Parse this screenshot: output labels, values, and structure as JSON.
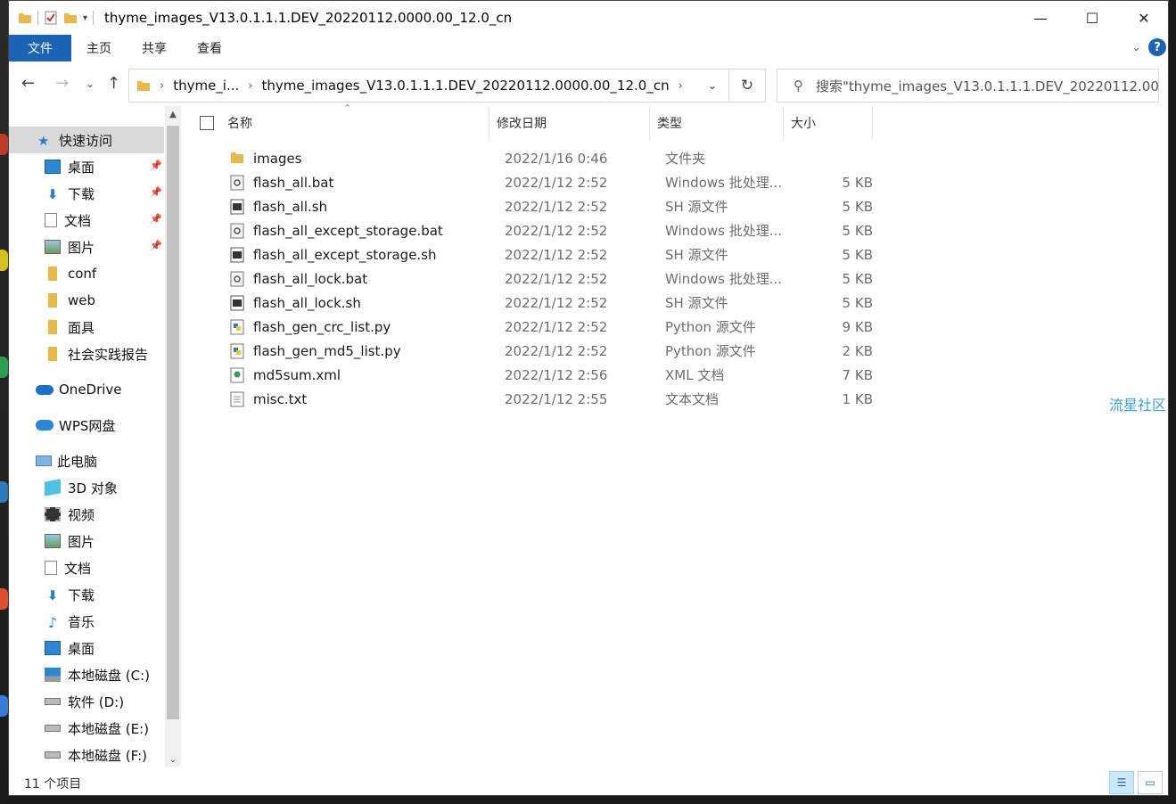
{
  "window": {
    "title": "thyme_images_V13.0.1.1.1.DEV_20220112.0000.00_12.0_cn",
    "controls": {
      "minimize": "—",
      "maximize": "☐",
      "close": "✕"
    }
  },
  "ribbon": {
    "tabs": [
      "文件",
      "主页",
      "共享",
      "查看"
    ],
    "help": "?"
  },
  "address": {
    "crumbs": [
      "thyme_i...",
      "thyme_images_V13.0.1.1.1.DEV_20220112.0000.00_12.0_cn"
    ],
    "search_placeholder": "搜索\"thyme_images_V13.0.1.1.1.DEV_20220112.00..."
  },
  "nav": {
    "quick_access": "快速访问",
    "pinned": [
      "桌面",
      "下载",
      "文档",
      "图片"
    ],
    "recent": [
      "conf",
      "web",
      "面具",
      "社会实践报告"
    ],
    "onedrive": "OneDrive",
    "wps": "WPS网盘",
    "this_pc": "此电脑",
    "pc_items": [
      "3D 对象",
      "视频",
      "图片",
      "文档",
      "下载",
      "音乐",
      "桌面",
      "本地磁盘 (C:)",
      "软件 (D:)",
      "本地磁盘 (E:)",
      "本地磁盘 (F:)"
    ]
  },
  "columns": {
    "name": "名称",
    "date": "修改日期",
    "type": "类型",
    "size": "大小"
  },
  "files": [
    {
      "name": "images",
      "date": "2022/1/16 0:46",
      "type": "文件夹",
      "size": "",
      "icon": "folder-icon"
    },
    {
      "name": "flash_all.bat",
      "date": "2022/1/12 2:52",
      "type": "Windows 批处理...",
      "size": "5 KB",
      "icon": "bat-file-icon"
    },
    {
      "name": "flash_all.sh",
      "date": "2022/1/12 2:52",
      "type": "SH 源文件",
      "size": "5 KB",
      "icon": "sh-file-icon"
    },
    {
      "name": "flash_all_except_storage.bat",
      "date": "2022/1/12 2:52",
      "type": "Windows 批处理...",
      "size": "5 KB",
      "icon": "bat-file-icon"
    },
    {
      "name": "flash_all_except_storage.sh",
      "date": "2022/1/12 2:52",
      "type": "SH 源文件",
      "size": "5 KB",
      "icon": "sh-file-icon"
    },
    {
      "name": "flash_all_lock.bat",
      "date": "2022/1/12 2:52",
      "type": "Windows 批处理...",
      "size": "5 KB",
      "icon": "bat-file-icon"
    },
    {
      "name": "flash_all_lock.sh",
      "date": "2022/1/12 2:52",
      "type": "SH 源文件",
      "size": "5 KB",
      "icon": "sh-file-icon"
    },
    {
      "name": "flash_gen_crc_list.py",
      "date": "2022/1/12 2:52",
      "type": "Python 源文件",
      "size": "9 KB",
      "icon": "python-file-icon"
    },
    {
      "name": "flash_gen_md5_list.py",
      "date": "2022/1/12 2:52",
      "type": "Python 源文件",
      "size": "2 KB",
      "icon": "python-file-icon"
    },
    {
      "name": "md5sum.xml",
      "date": "2022/1/12 2:56",
      "type": "XML 文档",
      "size": "7 KB",
      "icon": "xml-file-icon"
    },
    {
      "name": "misc.txt",
      "date": "2022/1/12 2:55",
      "type": "文本文档",
      "size": "1 KB",
      "icon": "txt-file-icon"
    }
  ],
  "status": {
    "count": "11 个项目"
  },
  "watermark": "流星社区",
  "colors": {
    "accent": "#1c63b7",
    "folder": "#e8b94a",
    "selected": "#d9d9d9"
  }
}
